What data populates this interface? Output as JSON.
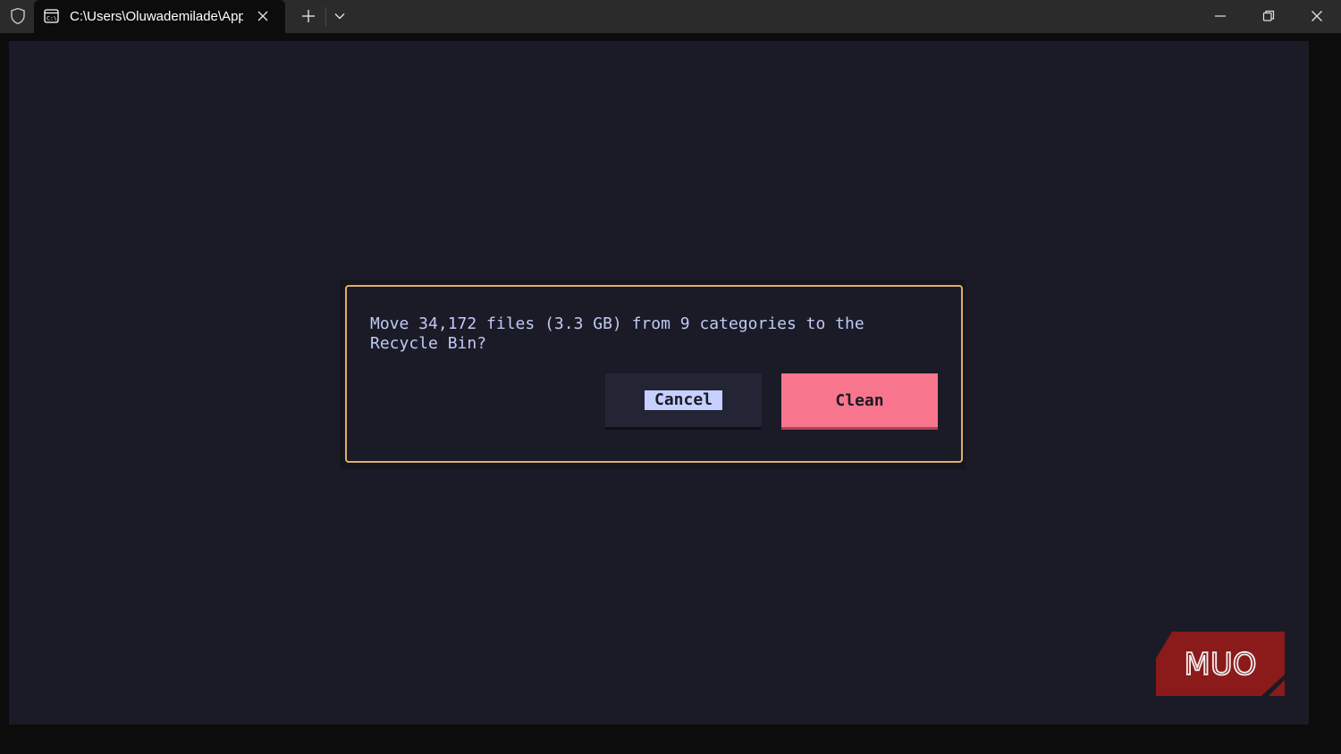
{
  "titlebar": {
    "tab_title": "C:\\Users\\Oluwademilade\\App",
    "icons": [
      "shield-icon",
      "terminal-tab-icon",
      "close-icon",
      "plus-icon",
      "chevron-down-icon",
      "minimize-icon",
      "restore-icon",
      "close-icon"
    ]
  },
  "dialog": {
    "message": "Move 34,172 files (3.3 GB) from 9 categories to the\nRecycle Bin?",
    "cancel_label": "Cancel",
    "clean_label": "Clean"
  },
  "watermark": {
    "text": "MUO"
  },
  "colors": {
    "background": "#1a1b26",
    "text": "#c0caf5",
    "dialog_border": "#e0af68",
    "clean_button": "#f7768e",
    "cancel_button": "#232535",
    "cancel_highlight": "#c6d0ff",
    "logo": "#8b1a1a"
  }
}
